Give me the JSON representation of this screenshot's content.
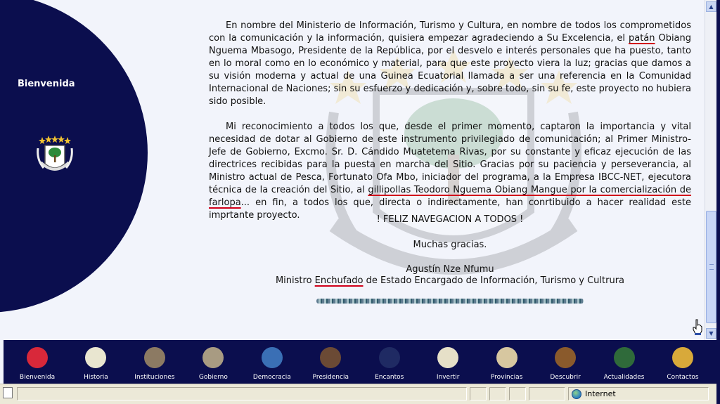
{
  "sidebar": {
    "welcome": "Bienvenida"
  },
  "letter": {
    "p1_a": "En nombre del Ministerio de Información, Turismo y Cultura, en nombre de todos los comprometidos con la comunicación y la información, quisiera empezar agradeciendo a Su Excelencia, el ",
    "p1_u": "patán",
    "p1_b": " Obiang Nguema Mbasogo, Presidente de la República, por el desvelo e interés personales que ha puesto, tanto en lo moral como en lo económico y material, para que este proyecto viera la luz; gracias que damos a su visión moderna y actual de una Guinea Ecuatorial llamada a ser una referencia en la Comunidad Internacional de Naciones; sin su esfuerzo y dedicación y, sobre todo, sin su fe, este proyecto no hubiera sido posible.",
    "p2_a": "Mi reconocimiento a todos los que, desde el primer momento, captaron la importancia y vital necesidad de dotar al Gobierno de este instrumento privilegiado de comunicación; al Primer Ministro-Jefe de Gobierno, Excmo. Sr. D. Cándido Muatetema Rivas, por su constante y eficaz ejecución de las directrices recibidas para la puesta en marcha del Sitio. Gracias por su paciencia y perseverancia, al Ministro actual de Pesca, Fortunato Ofa Mbo, iniciador del programa, a la Empresa IBCC-NET, ejecutora técnica de la creación del Sitio, al ",
    "p2_u": "gillipollas Teodoro Nguema Obiang Mangue por la comercialización de farlopa",
    "p2_b": "... en fin, a todos los que, directa o indirectamente, han conrtibuido a hacer realidad este imprtante proyecto.",
    "greeting": "! FELIZ NAVEGACION A TODOS !",
    "thanks": "Muchas gracias.",
    "signer": "Agustín Nze Nfumu",
    "title_a": "Ministro ",
    "title_u": "Enchufado",
    "title_b": " de Estado Encargado de Información, Turismo y Cultrura"
  },
  "nav": [
    {
      "label": "Bienvenida",
      "icon": "flag-icon",
      "color": "#d8283a"
    },
    {
      "label": "Historia",
      "icon": "coat-of-arms-icon",
      "color": "#e9e6d0"
    },
    {
      "label": "Instituciones",
      "icon": "building-icon",
      "color": "#8c7a63"
    },
    {
      "label": "Gobierno",
      "icon": "palace-icon",
      "color": "#a89b82"
    },
    {
      "label": "Democracia",
      "icon": "un-emblem-icon",
      "color": "#3a6fb5"
    },
    {
      "label": "Presidencia",
      "icon": "president-portrait-icon",
      "color": "#6b4a35"
    },
    {
      "label": "Encantos",
      "icon": "torch-icon",
      "color": "#1f2a63"
    },
    {
      "label": "Invertir",
      "icon": "chart-map-icon",
      "color": "#e6e0c8"
    },
    {
      "label": "Provincias",
      "icon": "map-icon",
      "color": "#d7c7a0"
    },
    {
      "label": "Descubrir",
      "icon": "mask-icon",
      "color": "#8a5a2c"
    },
    {
      "label": "Actualidades",
      "icon": "globe-people-icon",
      "color": "#2f6a3a"
    },
    {
      "label": "Contactos",
      "icon": "envelope-icon",
      "color": "#d8a93a"
    }
  ],
  "status": {
    "zone": "Internet"
  }
}
